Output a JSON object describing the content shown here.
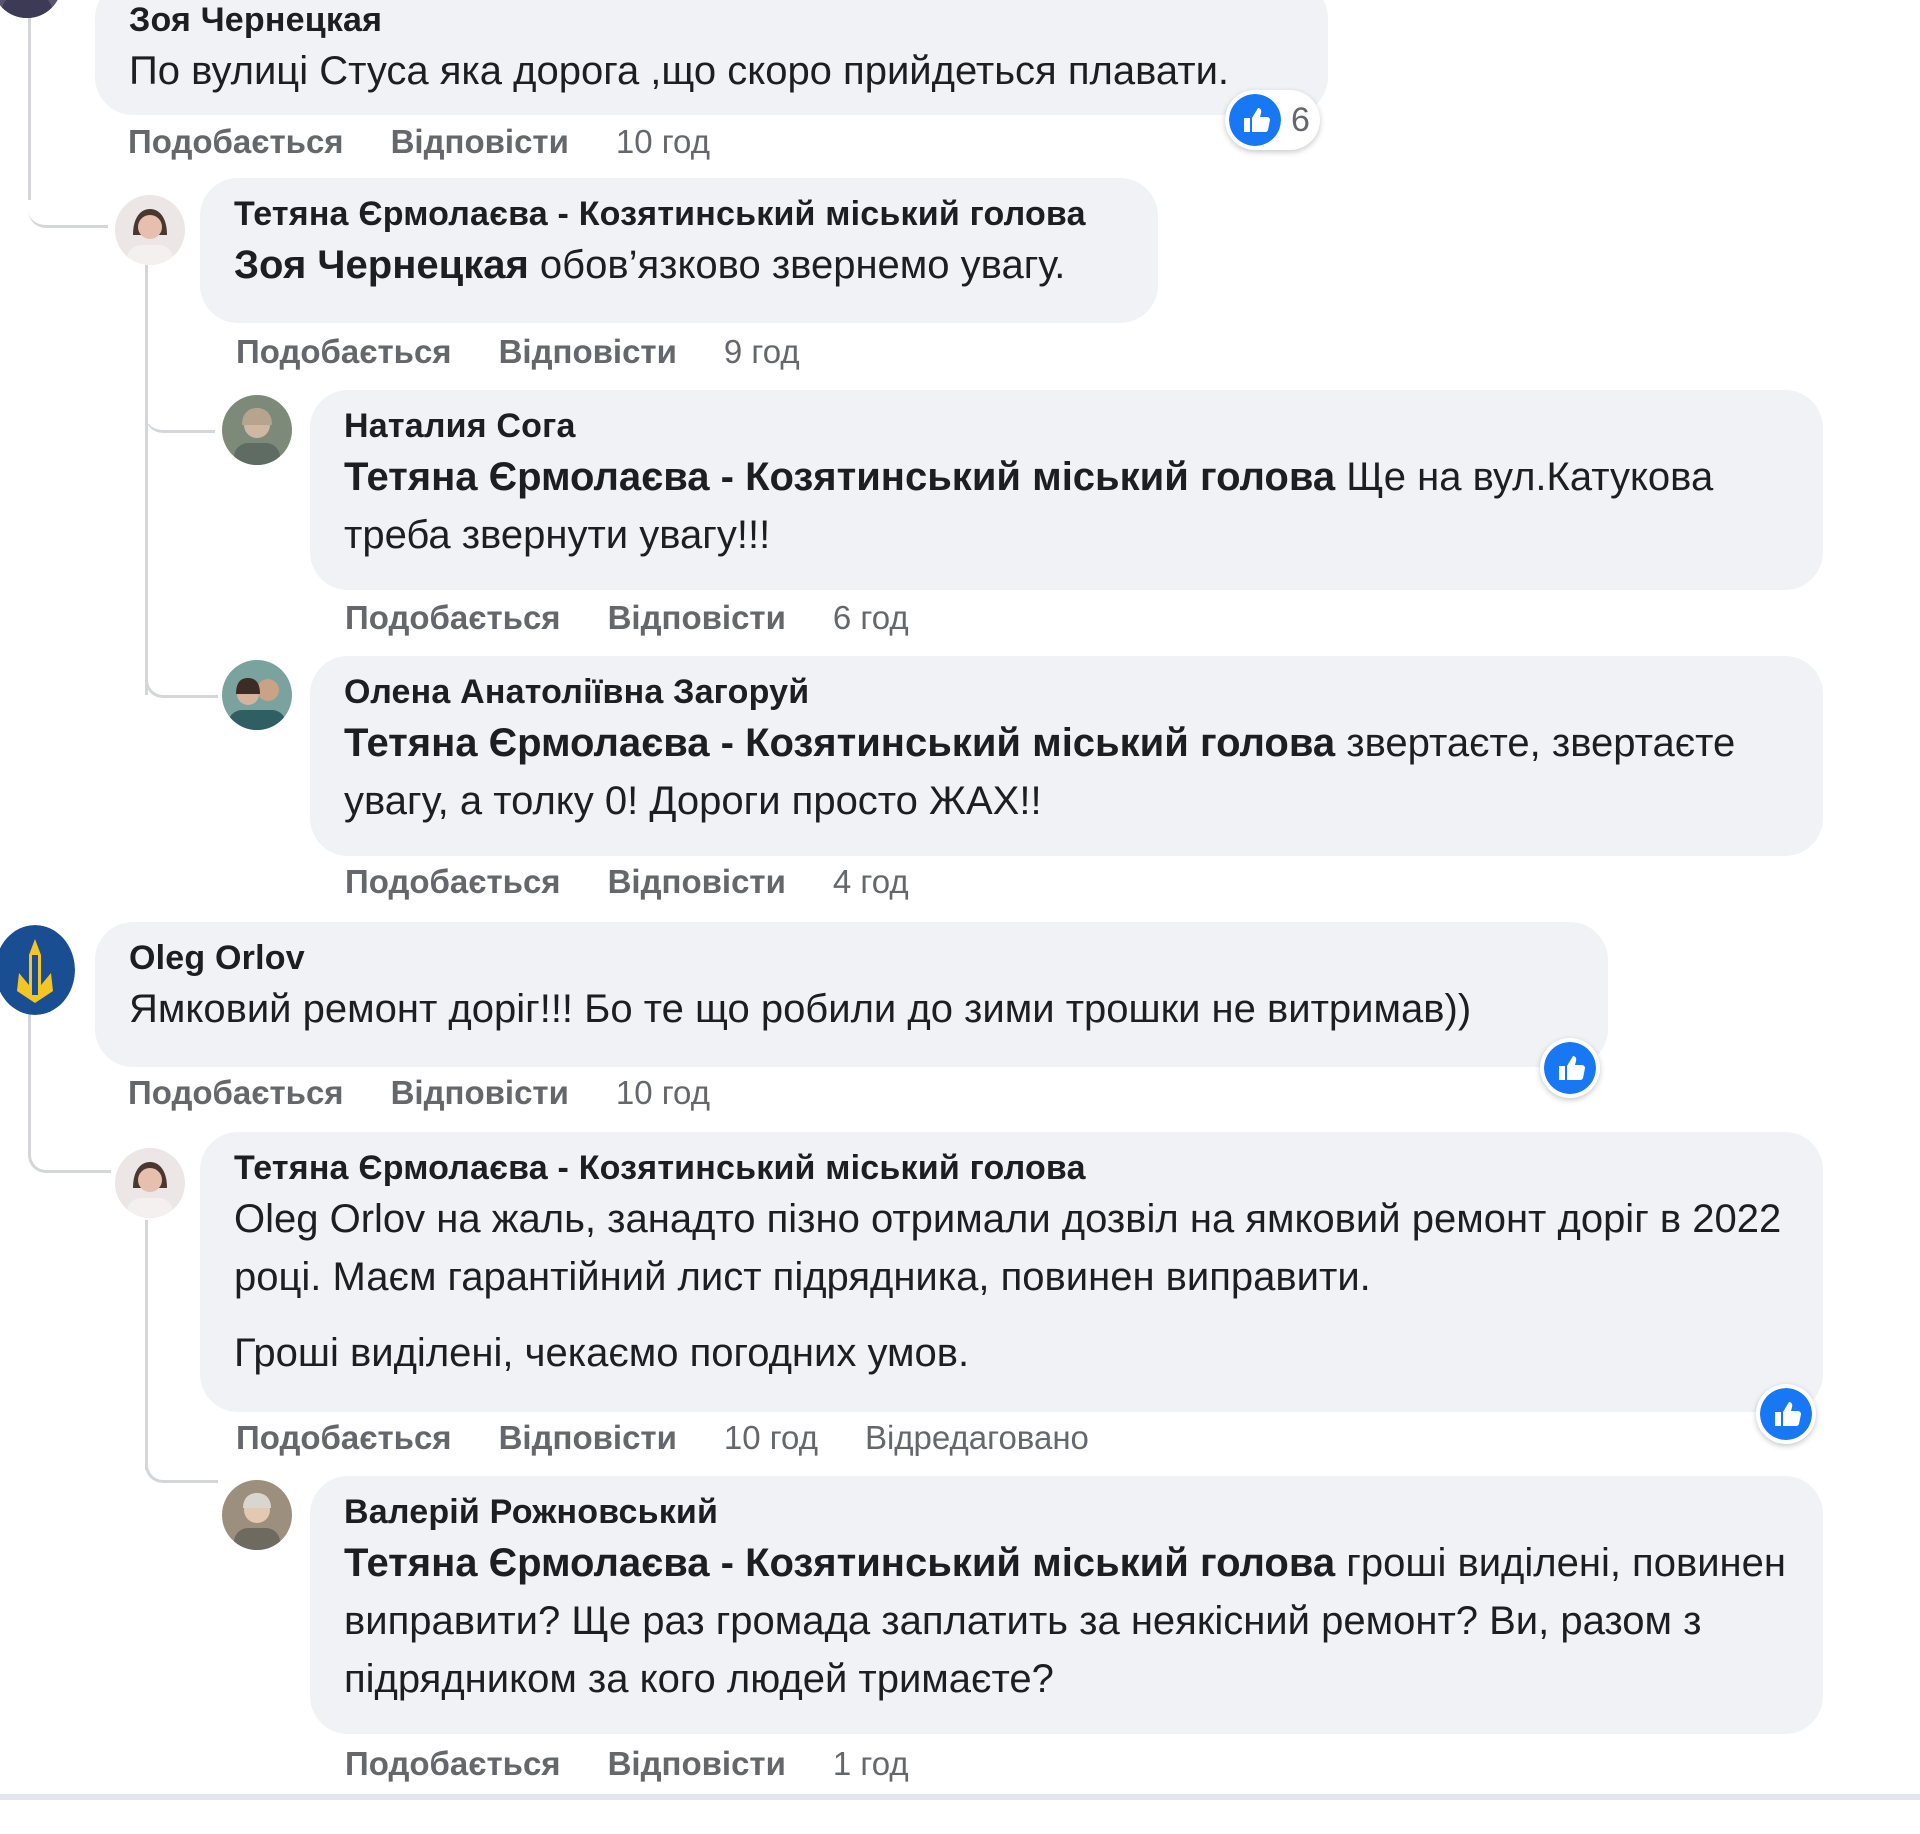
{
  "actions": {
    "like_label": "Подобається",
    "reply_label": "Відповісти",
    "edited_label": "Відредаговано"
  },
  "comments": [
    {
      "author": "Зоя Чернецкая",
      "text": "По вулиці Стуса яка дорога ,що скоро прийдеться плавати.",
      "time": "10 год",
      "reaction_count": "6"
    },
    {
      "author": "Тетяна Єрмолаєва - Козятинський міський голова",
      "mention": "Зоя Чернецкая",
      "text": " обов’язково звернемо увагу.",
      "time": "9 год"
    },
    {
      "author": "Наталия Сога",
      "mention": "Тетяна Єрмолаєва - Козятинський міський голова",
      "text": " Ще на вул.Катукова треба звернути увагу!!!",
      "time": "6 год"
    },
    {
      "author": "Олена Анатоліївна Загоруй",
      "mention": "Тетяна Єрмолаєва - Козятинський міський голова",
      "text": " звертаєте, звертаєте увагу, а толку 0! Дороги просто ЖАХ!!",
      "time": "4 год"
    },
    {
      "author": "Oleg Orlov",
      "text": "Ямковий ремонт доріг!!! Бо те що робили до зими трошки не витримав))",
      "time": "10 год"
    },
    {
      "author": "Тетяна Єрмолаєва - Козятинський міський голова",
      "text_p1": "Oleg Orlov на жаль, занадто пізно отримали дозвіл на ямковий ремонт доріг в 2022 році. Маєм гарантійний лист підрядника, повинен виправити.",
      "text_p2": "Гроші виділені, чекаємо погодних умов.",
      "time": "10 год"
    },
    {
      "author": "Валерій Рожновський",
      "mention": "Тетяна Єрмолаєва - Козятинський міський голова",
      "text": " гроші виділені, повинен виправити? Ще раз громада заплатить за неякісний ремонт? Ви, разом з підрядником за кого людей тримаєте?",
      "time": "1 год"
    }
  ],
  "colors": {
    "bubble": "#f0f2f5",
    "meta_text": "#65676b",
    "like_blue": "#1877f2",
    "thread_line": "#d4d6da"
  },
  "icons": {
    "like": "thumbs-up-icon"
  }
}
